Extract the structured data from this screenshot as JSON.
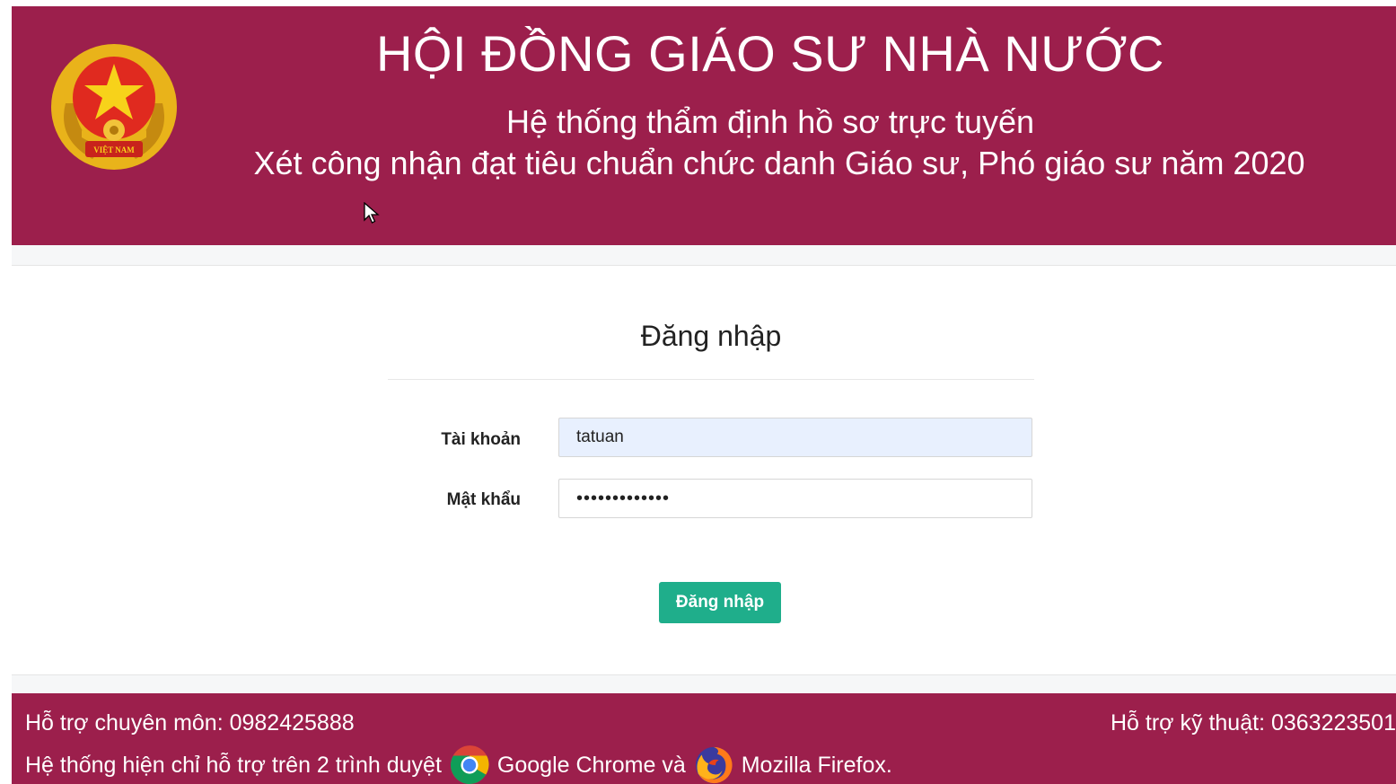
{
  "header": {
    "title": "HỘI ĐỒNG GIÁO SƯ NHÀ NƯỚC",
    "subtitle_1": "Hệ thống thẩm định hồ sơ trực tuyến",
    "subtitle_2": "Xét công nhận đạt tiêu chuẩn chức danh Giáo sư, Phó giáo sư năm 2020",
    "emblem_icon": "vietnam-national-emblem-icon",
    "emblem_text": "VIỆT NAM"
  },
  "login": {
    "title": "Đăng nhập",
    "username_label": "Tài khoản",
    "username_value": "tatuan",
    "password_label": "Mật khẩu",
    "password_value": "•••••••••••••",
    "submit_label": "Đăng nhập"
  },
  "footer": {
    "support_pro": "Hỗ trợ chuyên môn: 0982425888",
    "support_tech": "Hỗ trợ kỹ thuật: 0363223501",
    "browser_prefix": "Hệ thống hiện chỉ hỗ trợ trên 2 trình duyệt",
    "browser_chrome": "Google Chrome và",
    "browser_firefox": "Mozilla Firefox.",
    "chrome_icon": "google-chrome-icon",
    "firefox_icon": "mozilla-firefox-icon"
  },
  "colors": {
    "brand": "#9c1f4c",
    "button": "#1fae8b",
    "input_autofill": "#e8f0fe"
  }
}
